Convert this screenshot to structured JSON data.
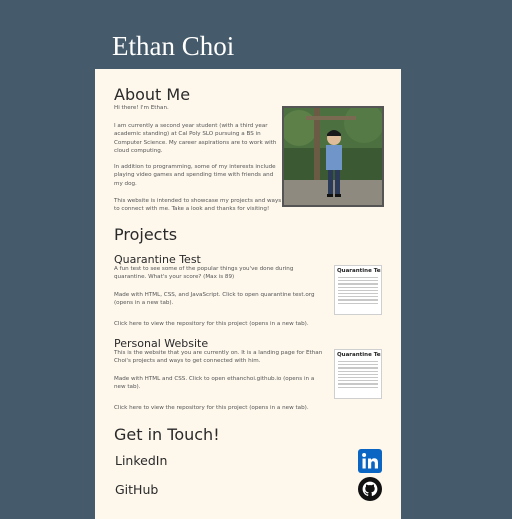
{
  "header": {
    "title": "Ethan Choi"
  },
  "about": {
    "heading": "About Me",
    "greeting": "Hi there! I'm Ethan.",
    "paragraphs": [
      "I am currently a second year student (with a third year academic standing) at Cal Poly SLO pursuing a BS in Computer Science. My career aspirations are to work with cloud computing.",
      "In addition to programming, some of my interests include playing video games and spending time with friends and my dog.",
      "This website is intended to showcase my projects and ways to connect with me. Take a look and thanks for visiting!"
    ],
    "photo_alt": "Ethan Choi"
  },
  "projects": {
    "heading": "Projects",
    "items": [
      {
        "title": "Quarantine Test",
        "description": "A fun test to see some of the popular things you've done during quarantine. What's your score? (Max is 89)",
        "tech": "Made with HTML, CSS, and JavaScript. Click to open quarantine test.org (opens in a new tab).",
        "repo": "Click here to view the repository for this project (opens in a new tab).",
        "thumb_title": "Quarantine Test"
      },
      {
        "title": "Personal Website",
        "description": "This is the website that you are currently on. It is a landing page for Ethan Choi's projects and ways to get connected with him.",
        "tech": "Made with HTML and CSS. Click to open ethanchoi.github.io (opens in a new tab).",
        "repo": "Click here to view the repository for this project (opens in a new tab).",
        "thumb_title": "Quarantine Test"
      }
    ]
  },
  "contact": {
    "heading": "Get in Touch!",
    "links": [
      {
        "label": "LinkedIn",
        "icon": "linkedin-icon",
        "color": "#0a66c2"
      },
      {
        "label": "GitHub",
        "icon": "github-icon",
        "color": "#111111"
      }
    ]
  },
  "colors": {
    "background": "#455a6a",
    "card": "#fdf7ec"
  }
}
